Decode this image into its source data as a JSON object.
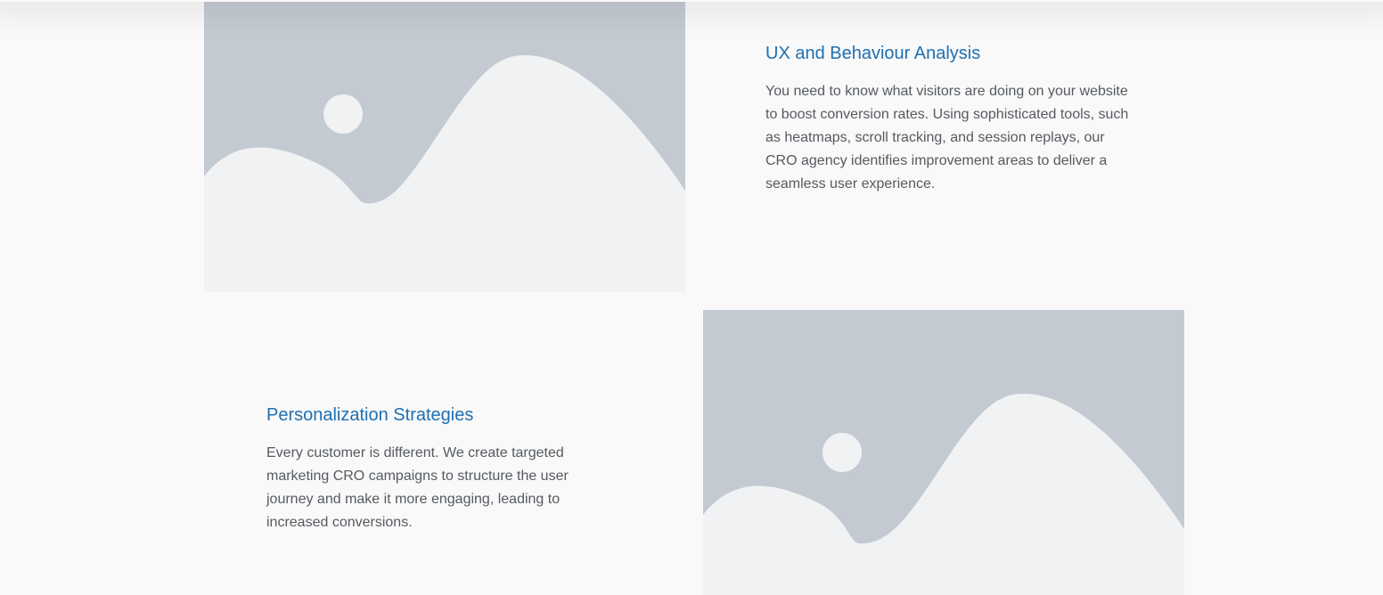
{
  "features": [
    {
      "title": "UX and Behaviour Analysis",
      "text": "You need to know what visitors are doing on your website to boost conversion rates. Using sophisticated tools, such as heatmaps, scroll tracking, and session replays, our CRO agency identifies improvement areas to deliver a seamless user experience.",
      "image_icon": "image-placeholder-icon"
    },
    {
      "title": "Personalization Strategies",
      "text": "Every customer is different. We create targeted marketing CRO campaigns to structure the user journey and make it more engaging, leading to increased conversions.",
      "image_icon": "image-placeholder-icon"
    }
  ],
  "colors": {
    "background": "#f9f9f9",
    "title": "#1f6fb2",
    "body_text": "#555a60",
    "placeholder_sky": "#c3cad2",
    "placeholder_hill": "#f1f2f4"
  }
}
